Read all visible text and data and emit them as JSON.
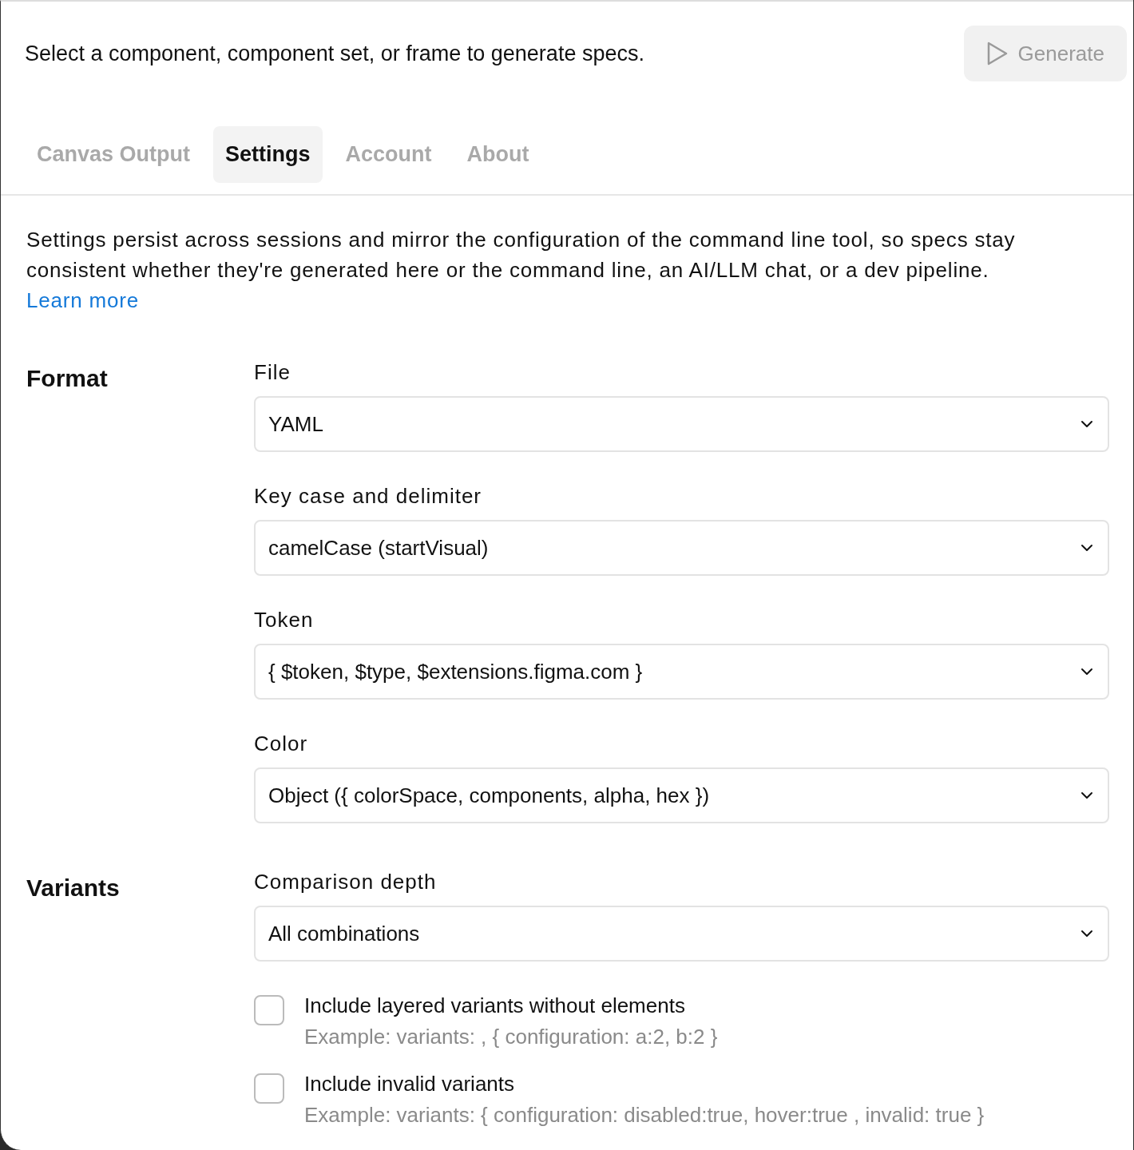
{
  "header": {
    "prompt": "Select a component, component set, or frame to generate specs.",
    "generate_button": {
      "label": "Generate",
      "disabled": true
    }
  },
  "tabs": [
    {
      "label": "Canvas Output",
      "selected": false
    },
    {
      "label": "Settings",
      "selected": true
    },
    {
      "label": "Account",
      "selected": false
    },
    {
      "label": "About",
      "selected": false
    }
  ],
  "intro": {
    "text": "Settings persist across sessions and mirror the configuration of the command line tool, so specs stay consistent whether they're generated here or the command line, an AI/LLM chat, or a dev pipeline.",
    "link": "Learn more"
  },
  "sections": [
    {
      "title": "Format",
      "fields": [
        {
          "kind": "select",
          "label": "File",
          "value": "YAML"
        },
        {
          "kind": "select",
          "label": "Key case and delimiter",
          "value": "camelCase (startVisual)"
        },
        {
          "kind": "select",
          "label": "Token",
          "value": "{ $token, $type, $extensions.figma.com }"
        },
        {
          "kind": "select",
          "label": "Color",
          "value": "Object ({ colorSpace, components, alpha, hex })"
        }
      ]
    },
    {
      "title": "Variants",
      "fields": [
        {
          "kind": "select",
          "label": "Comparison depth",
          "value": "All combinations"
        },
        {
          "kind": "checkbox",
          "label": "Include layered variants without elements",
          "hint": "Example: variants: , { configuration: a:2, b:2 }",
          "checked": false
        },
        {
          "kind": "checkbox",
          "label": "Include invalid variants",
          "hint": "Example: variants: { configuration: disabled:true, hover:true , invalid: true }",
          "checked": false
        }
      ]
    }
  ]
}
